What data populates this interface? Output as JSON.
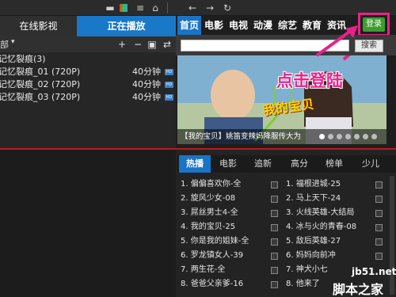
{
  "left_panel": {
    "tabs": [
      "在线影视",
      "正在播放"
    ],
    "toolbar_label": "部",
    "playlist": [
      {
        "title": "记忆裂痕(3)",
        "duration": "",
        "hd": false
      },
      {
        "title": "记忆裂痕_01 (720P)",
        "duration": "40分钟",
        "hd": true
      },
      {
        "title": "记忆裂痕_02 (720P)",
        "duration": "40分钟",
        "hd": true
      },
      {
        "title": "记忆裂痕_03 (720P)",
        "duration": "40分钟",
        "hd": true
      }
    ],
    "hd_badge": "HD"
  },
  "nav": {
    "items": [
      "首页",
      "电影",
      "电视",
      "动漫",
      "综艺",
      "教育",
      "资讯"
    ],
    "login_label": "登录"
  },
  "search": {
    "placeholder": "",
    "button_label": "搜索"
  },
  "banner": {
    "caption": "【我的宝贝】姚笛变辣妈降服传大为",
    "callout": "点击登陆",
    "logo_text": "我的宝贝",
    "active_dot": 0,
    "dot_count": 7
  },
  "hot_list": {
    "tabs": [
      "热播",
      "电影",
      "追新",
      "高分",
      "榜单",
      "少儿"
    ],
    "left_column": [
      "1. 偏偏喜欢你-全",
      "2. 旋风少女-08",
      "3. 屌丝男士4-全",
      "4. 我的宝贝-25",
      "5. 你是我的姐妹-全",
      "6. 罗龙镇女人-39",
      "7. 两生花-全",
      "8. 爸爸父亲爹-16"
    ],
    "right_column": [
      "1. 福根进城-25",
      "2. 马上天下-24",
      "3. 火线英雄-大结局",
      "4. 冰与火的青春-08",
      "5. 敌后英雄-27",
      "6. 妈妈向前冲",
      "7. 神犬小七",
      "8. 他来了"
    ]
  },
  "watermark": {
    "line1": "jb51.net",
    "line2": "脚本之家"
  },
  "colors": {
    "accent_blue": "#1a73c6",
    "login_green": "#3d9d2c",
    "highlight_pink": "#e8228a",
    "divider_red": "#b51c1c"
  }
}
